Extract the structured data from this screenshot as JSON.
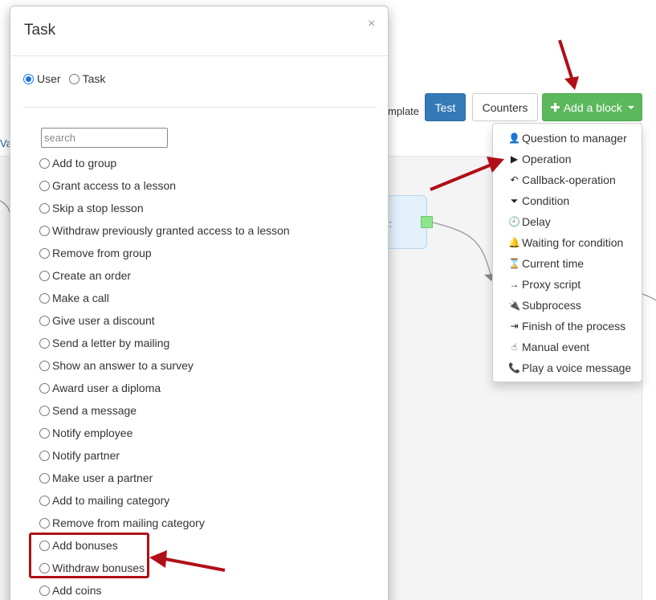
{
  "background": {
    "left_link_text": "Va",
    "template_text": "mplate",
    "node_label": "s:"
  },
  "toolbar": {
    "test_label": "Test",
    "counters_label": "Counters",
    "add_block_label": "Add a block",
    "add_block_icon": "plus-icon"
  },
  "dropdown": {
    "items": [
      {
        "label": "Question to manager",
        "icon": "user-icon",
        "glyph": "👤"
      },
      {
        "label": "Operation",
        "icon": "play-icon",
        "glyph": "▶"
      },
      {
        "label": "Callback-operation",
        "icon": "reply-icon",
        "glyph": "↶"
      },
      {
        "label": "Condition",
        "icon": "filter-icon",
        "glyph": "⏷"
      },
      {
        "label": "Delay",
        "icon": "clock-icon",
        "glyph": "🕘"
      },
      {
        "label": "Waiting for condition",
        "icon": "bell-icon",
        "glyph": "🔔"
      },
      {
        "label": "Current time",
        "icon": "hourglass-icon",
        "glyph": "⌛"
      },
      {
        "label": "Proxy script",
        "icon": "arrow-right-icon",
        "glyph": "→"
      },
      {
        "label": "Subprocess",
        "icon": "plug-icon",
        "glyph": "🔌"
      },
      {
        "label": "Finish of the process",
        "icon": "sign-out-icon",
        "glyph": "⇥"
      },
      {
        "label": "Manual event",
        "icon": "hand-pointer-icon",
        "glyph": "☝"
      },
      {
        "label": "Play a voice message",
        "icon": "phone-icon",
        "glyph": "📞"
      }
    ]
  },
  "modal": {
    "title": "Task",
    "close_glyph": "×",
    "type_options": [
      {
        "label": "User",
        "checked": true
      },
      {
        "label": "Task",
        "checked": false
      }
    ],
    "search_placeholder": "search",
    "tasks": [
      "Add to group",
      "Grant access to a lesson",
      "Skip a stop lesson",
      "Withdraw previously granted access to a lesson",
      "Remove from group",
      "Create an order",
      "Make a call",
      "Give user a discount",
      "Send a letter by mailing",
      "Show an answer to a survey",
      "Award user a diploma",
      "Send a message",
      "Notify employee",
      "Notify partner",
      "Make user a partner",
      "Add to mailing category",
      "Remove from mailing category",
      "Add bonuses",
      "Withdraw bonuses",
      "Add coins"
    ]
  },
  "colors": {
    "test_button": "#337ab7",
    "add_button": "#5cb85c",
    "annotation": "#b00f17",
    "radio_checked": "#1a73e8"
  }
}
